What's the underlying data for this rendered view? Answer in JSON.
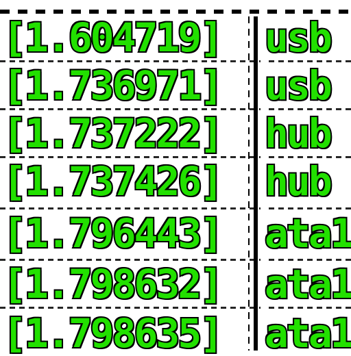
{
  "terminal": {
    "colors": {
      "text": "#22e000",
      "outline": "#000000",
      "background": "#ffffff"
    },
    "lines": [
      {
        "time": "[1.604719]",
        "device": "usb"
      },
      {
        "time": "[1.736971]",
        "device": "usb"
      },
      {
        "time": "[1.737222]",
        "device": "hub"
      },
      {
        "time": "[1.737426]",
        "device": "hub"
      },
      {
        "time": "[1.796443]",
        "device": "ata1"
      },
      {
        "time": "[1.798632]",
        "device": "ata1"
      },
      {
        "time": "[1.798635]",
        "device": "ata1"
      }
    ]
  }
}
